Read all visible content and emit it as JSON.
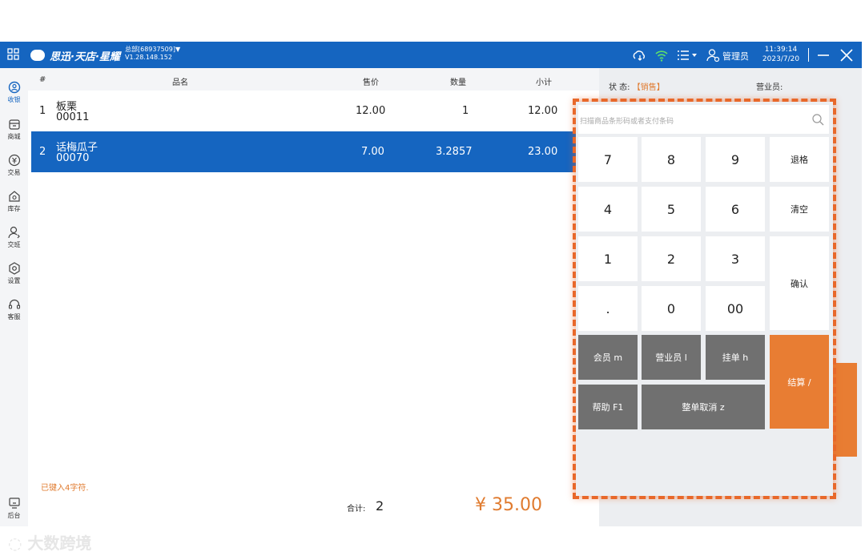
{
  "topbar": {
    "brand": "思迅·天店·星耀",
    "store_line1": "总部[68937509]▼",
    "store_line2": "V1.28.148.152",
    "admin_label": "管理员",
    "time": "11:39:14",
    "date": "2023/7/20"
  },
  "sidebar": {
    "items": [
      {
        "label": "收银",
        "icon": "cashier-icon"
      },
      {
        "label": "商城",
        "icon": "mall-icon"
      },
      {
        "label": "交易",
        "icon": "transaction-icon"
      },
      {
        "label": "库存",
        "icon": "inventory-icon"
      },
      {
        "label": "交班",
        "icon": "shift-icon"
      },
      {
        "label": "设置",
        "icon": "settings-icon"
      },
      {
        "label": "客服",
        "icon": "headset-icon"
      }
    ],
    "bottom_label": "后台"
  },
  "table": {
    "headers": {
      "index": "#",
      "name": "品名",
      "price": "售价",
      "qty": "数量",
      "subtotal": "小计"
    },
    "rows": [
      {
        "index": "1",
        "name": "板栗",
        "code": "00011",
        "price": "12.00",
        "qty": "1",
        "subtotal": "12.00"
      },
      {
        "index": "2",
        "name": "话梅瓜子",
        "code": "00070",
        "price": "7.00",
        "qty": "3.2857",
        "subtotal": "23.00"
      }
    ]
  },
  "footer": {
    "status_note": "已键入4字符.",
    "total_label": "合计:",
    "total_count": "2",
    "total_amount": "¥ 35.00"
  },
  "right_panel": {
    "state_label": "状 态:",
    "state_value": "【销售】",
    "salesperson_label": "营业员:"
  },
  "keypad": {
    "search_placeholder": "扫描商品条形码或者支付条码",
    "keys": {
      "k7": "7",
      "k8": "8",
      "k9": "9",
      "backspace": "退格",
      "k4": "4",
      "k5": "5",
      "k6": "6",
      "clear": "清空",
      "k1": "1",
      "k2": "2",
      "k3": "3",
      "confirm": "确认",
      "dot": ".",
      "k0": "0",
      "k00": "00",
      "member": "会员 m",
      "salesperson": "营业员 l",
      "hold": "挂单 h",
      "checkout": "结算 /",
      "help": "帮助 F1",
      "void_all": "整单取消 z"
    }
  },
  "colors": {
    "primary": "#1565c0",
    "accent": "#e87d33",
    "highlight_border": "#e8682a"
  }
}
